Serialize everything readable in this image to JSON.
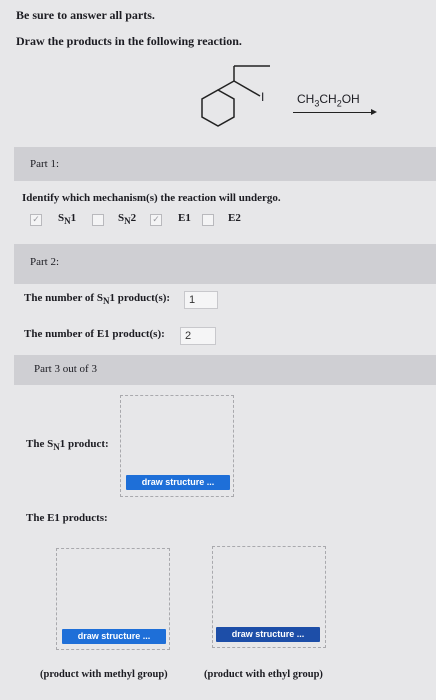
{
  "header": {
    "line1": "Be sure to answer all parts.",
    "line2": "Draw the products in the following reaction."
  },
  "reaction": {
    "leaving_group": "I",
    "reagent_parts": [
      "CH",
      "3",
      "CH",
      "2",
      "OH"
    ]
  },
  "part1": {
    "label": "Part 1:",
    "question": "Identify which mechanism(s) the reaction will undergo.",
    "options": [
      {
        "main": "S",
        "sub": "N",
        "tail": "1",
        "checked": true
      },
      {
        "main": "S",
        "sub": "N",
        "tail": "2",
        "checked": false
      },
      {
        "main": "E1",
        "sub": "",
        "tail": "",
        "checked": true
      },
      {
        "main": "E2",
        "sub": "",
        "tail": "",
        "checked": false
      }
    ]
  },
  "part2": {
    "label": "Part 2:",
    "q1_pre": "The number of S",
    "q1_sub": "N",
    "q1_post": "1 product(s):",
    "q1_value": "1",
    "q2": "The number of E1 product(s):",
    "q2_value": "2"
  },
  "part3": {
    "label": "Part 3 out of 3",
    "sn1_pre": "The S",
    "sn1_sub": "N",
    "sn1_post": "1 product:",
    "e1_label": "The E1 products:",
    "draw_button": "draw structure ...",
    "caption_left": "(product with methyl group)",
    "caption_right": "(product with ethyl group)"
  }
}
